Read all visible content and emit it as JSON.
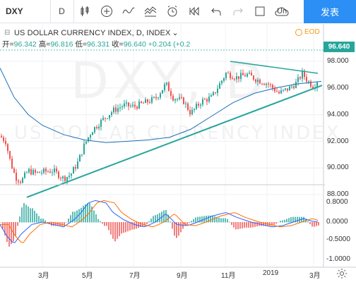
{
  "toolbar": {
    "symbol": "DXY",
    "interval": "D",
    "partial_text": "Un",
    "publish_label": "发表"
  },
  "chart": {
    "title": "US DOLLAR CURRENCY INDEX, D, INDEX",
    "ohlc": {
      "open_label": "开=",
      "open": "96.342",
      "high_label": "高=",
      "high": "96.816",
      "low_label": "低=",
      "low": "96.331",
      "close_label": "收=",
      "close": "96.640",
      "change": "+0.204 (+0.2"
    },
    "eod_label": "EOD",
    "last_price": "96.640",
    "watermark_symbol": "DXY, D",
    "watermark_name": "US DOLLAR CURRENCY INDEX",
    "price_axis": [
      "98.000",
      "96.000",
      "94.000",
      "92.000",
      "90.000",
      "88.000"
    ],
    "indicator_axis": [
      "0.8000",
      "0.0000",
      "-0.5000",
      "-1.0000"
    ],
    "dates": [
      "3月",
      "5月",
      "7月",
      "9月",
      "11月",
      "2019",
      "3月"
    ],
    "colors": {
      "up": "#26a69a",
      "down": "#ef5350",
      "trend": "#26a69a",
      "ma": "#1e6fb5",
      "macd": "#2962ff",
      "signal": "#ff6d00"
    }
  }
}
